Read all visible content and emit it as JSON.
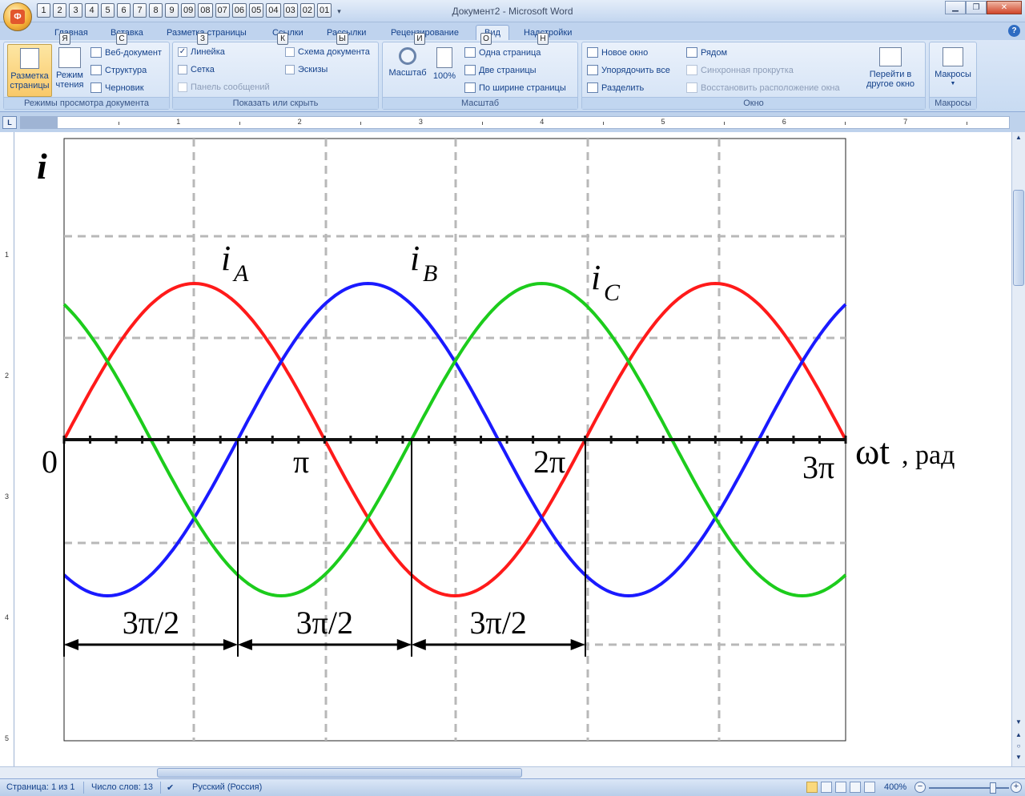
{
  "window": {
    "title": "Документ2 - Microsoft Word"
  },
  "office_button": {
    "letter": "Ф"
  },
  "qat_keytips": [
    "1",
    "2",
    "3",
    "4",
    "5",
    "6",
    "7",
    "8",
    "9",
    "09",
    "08",
    "07",
    "06",
    "05",
    "04",
    "03",
    "02",
    "01"
  ],
  "tabs": [
    {
      "label": "Главная",
      "keytip": ""
    },
    {
      "label": "Вставка",
      "keytip": "Я"
    },
    {
      "label": "Разметка страницы",
      "keytip": "С"
    },
    {
      "label": "Ссылки",
      "keytip": "З"
    },
    {
      "label": "Рассылки",
      "keytip": "К"
    },
    {
      "label": "Рецензирование",
      "keytip": "Ы"
    },
    {
      "label": "Вид",
      "keytip": "И"
    },
    {
      "label": "Надстройки",
      "keytip": "О"
    }
  ],
  "extra_keytip": "Н",
  "ribbon": {
    "views": {
      "label": "Режимы просмотра документа",
      "page_layout": "Разметка страницы",
      "page_layout_l1": "Разметка",
      "page_layout_l2": "страницы",
      "reading_l1": "Режим",
      "reading_l2": "чтения",
      "web": "Веб-документ",
      "outline": "Структура",
      "draft": "Черновик"
    },
    "show": {
      "label": "Показать или скрыть",
      "ruler": "Линейка",
      "grid": "Сетка",
      "message_bar": "Панель сообщений",
      "doc_map": "Схема документа",
      "thumbnails": "Эскизы",
      "ruler_checked": true
    },
    "zoom": {
      "label": "Масштаб",
      "zoom_btn": "Масштаб",
      "hundred": "100%",
      "one_page": "Одна страница",
      "two_pages": "Две страницы",
      "page_width": "По ширине страницы"
    },
    "window": {
      "label": "Окно",
      "new_window": "Новое окно",
      "arrange_all": "Упорядочить все",
      "split": "Разделить",
      "side_by_side": "Рядом",
      "sync_scroll": "Синхронная прокрутка",
      "reset_pos": "Восстановить расположение окна",
      "switch_l1": "Перейти в",
      "switch_l2": "другое окно"
    },
    "macros": {
      "label": "Макросы",
      "btn": "Макросы"
    }
  },
  "ruler": {
    "numbers": [
      "1",
      "2",
      "3",
      "4",
      "5",
      "6",
      "7"
    ],
    "vnumbers": [
      "1",
      "2",
      "3",
      "4",
      "5"
    ]
  },
  "status": {
    "page": "Страница: 1 из 1",
    "words": "Число слов: 13",
    "lang": "Русский (Россия)",
    "zoom": "400%"
  },
  "chart_data": {
    "type": "line",
    "ylabel": "i",
    "xlabel": "ωt",
    "xunit": ", рад",
    "x_range_rad_over_pi": [
      0,
      3
    ],
    "ylim": [
      -1,
      1
    ],
    "grid": true,
    "x_tick_labels": [
      {
        "label": "0",
        "value": 0
      },
      {
        "label": "π",
        "value": 1
      },
      {
        "label": "2π",
        "value": 2
      },
      {
        "label": "3π",
        "value": 3
      }
    ],
    "series": [
      {
        "name": "A",
        "label_base": "i",
        "label_sub": "A",
        "color": "#ff1a1a",
        "amplitude": 1,
        "phase_deg": 0
      },
      {
        "name": "B",
        "label_base": "i",
        "label_sub": "B",
        "color": "#1a1aff",
        "amplitude": 1,
        "phase_deg": -120
      },
      {
        "name": "C",
        "label_base": "i",
        "label_sub": "C",
        "color": "#1ccc1c",
        "amplitude": 1,
        "phase_deg": 120
      }
    ],
    "intervals": [
      {
        "label": "3π/2",
        "from": 0,
        "to": 0.6667
      },
      {
        "label": "3π/2",
        "from": 0.6667,
        "to": 1.3333
      },
      {
        "label": "3π/2",
        "from": 1.3333,
        "to": 2.0
      }
    ]
  }
}
